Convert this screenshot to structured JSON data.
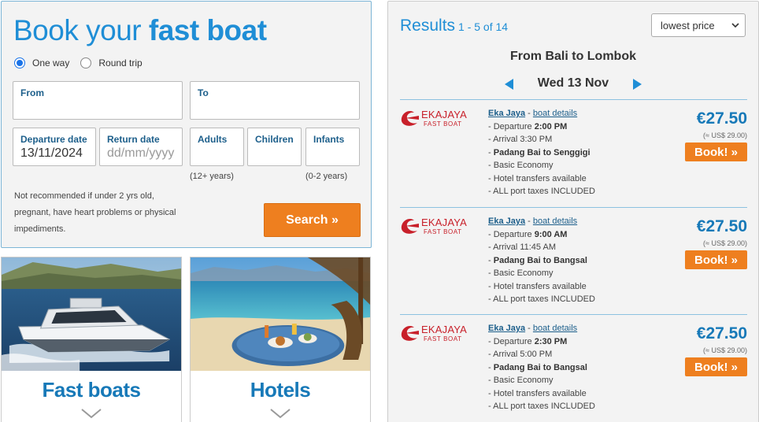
{
  "booking": {
    "title_plain": "Book your ",
    "title_bold": "fast boat",
    "trip_types": [
      {
        "label": "One way",
        "selected": true
      },
      {
        "label": "Round trip",
        "selected": false
      }
    ],
    "from_label": "From",
    "to_label": "To",
    "departure_label": "Departure date",
    "departure_value": "13/11/2024",
    "return_label": "Return date",
    "return_placeholder": "dd/mm/yyyy",
    "adults_label": "Adults",
    "adults_hint": "(12+ years)",
    "children_label": "Children",
    "infants_label": "Infants",
    "infants_hint": "(0-2 years)",
    "warning": "Not recommended if under 2 yrs old, pregnant, have heart problems or physical impediments.",
    "search_label": "Search »",
    "accent_color": "#1f8ed6",
    "button_color": "#ee7f1f"
  },
  "cards": [
    {
      "title": "Fast boats",
      "image": "speedboat-photo"
    },
    {
      "title": "Hotels",
      "image": "beach-table-photo"
    }
  ],
  "results": {
    "heading": "Results",
    "count": "1 - 5 of 14",
    "sort_value": "lowest price",
    "route": "From Bali to Lombok",
    "date": "Wed 13 Nov",
    "items": [
      {
        "logo_top": "EKAJAYA",
        "logo_bottom": "FAST BOAT",
        "operator": "Eka Jaya",
        "sep": "-",
        "details_link": "boat details",
        "departure_prefix": "- Departure ",
        "departure": "2:00 PM",
        "arrival": "- Arrival 3:30 PM",
        "dash": "- ",
        "route": "Padang Bai to Senggigi",
        "class": "- Basic Economy",
        "transfers": "- Hotel transfers available",
        "taxes": "- ALL port taxes INCLUDED",
        "price": "€27.50",
        "usd": "(≈ US$ 29.00)",
        "book_label": "Book! »"
      },
      {
        "logo_top": "EKAJAYA",
        "logo_bottom": "FAST BOAT",
        "operator": "Eka Jaya",
        "sep": "-",
        "details_link": "boat details",
        "departure_prefix": "- Departure ",
        "departure": "9:00 AM",
        "arrival": "- Arrival 11:45 AM",
        "dash": "- ",
        "route": "Padang Bai to Bangsal",
        "class": "- Basic Economy",
        "transfers": "- Hotel transfers available",
        "taxes": "- ALL port taxes INCLUDED",
        "price": "€27.50",
        "usd": "(≈ US$ 29.00)",
        "book_label": "Book! »"
      },
      {
        "logo_top": "EKAJAYA",
        "logo_bottom": "FAST BOAT",
        "operator": "Eka Jaya",
        "sep": "-",
        "details_link": "boat details",
        "departure_prefix": "- Departure ",
        "departure": "2:30 PM",
        "arrival": "- Arrival 5:00 PM",
        "dash": "- ",
        "route": "Padang Bai to Bangsal",
        "class": "- Basic Economy",
        "transfers": "- Hotel transfers available",
        "taxes": "- ALL port taxes INCLUDED",
        "price": "€27.50",
        "usd": "(≈ US$ 29.00)",
        "book_label": "Book! »"
      }
    ]
  }
}
